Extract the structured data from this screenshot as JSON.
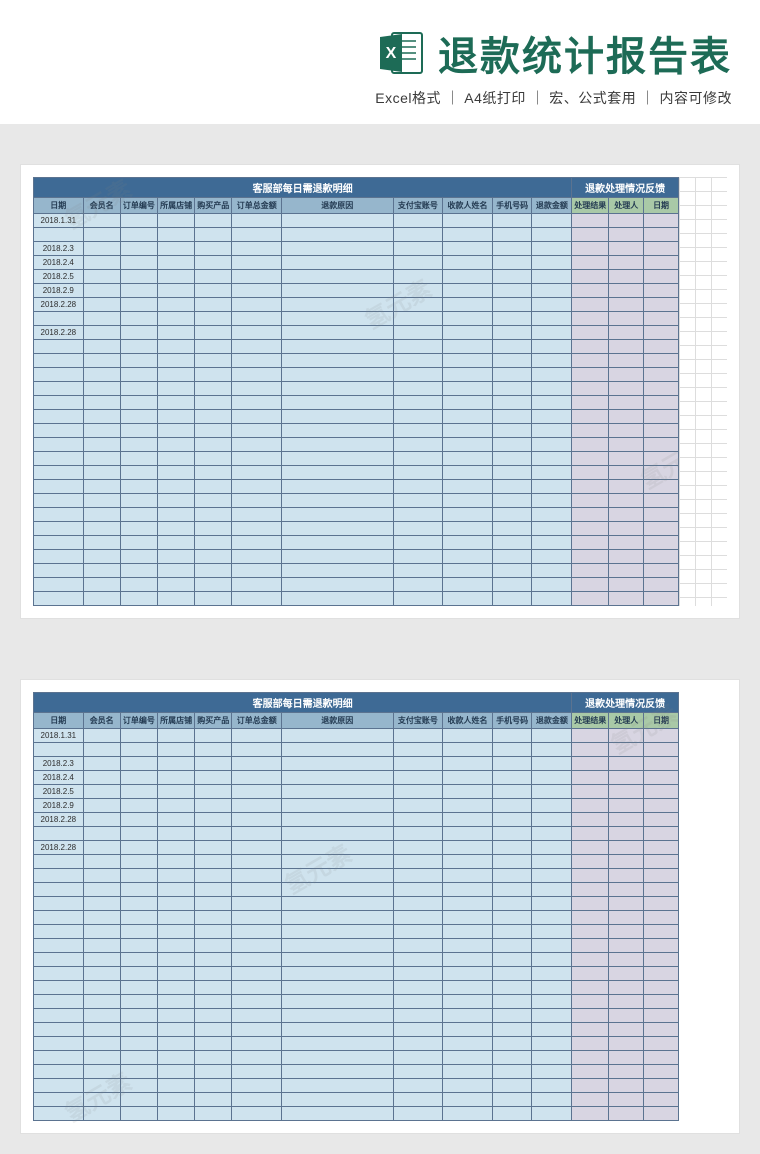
{
  "header": {
    "title": "退款统计报告表",
    "subtitle_parts": [
      "Excel格式",
      "A4纸打印",
      "宏、公式套用",
      "内容可修改"
    ],
    "separator": " ｜ "
  },
  "sheet": {
    "merged_headers": {
      "left": "客服部每日需退款明细",
      "right": "退款处理情况反馈"
    },
    "columns_main": [
      "日期",
      "会员名",
      "订单编号",
      "所属店铺",
      "购买产品",
      "订单总金额",
      "退款原因",
      "支付宝账号",
      "收款人姓名",
      "手机号码",
      "退款金额"
    ],
    "columns_feedback": [
      "处理结果",
      "处理人",
      "日期"
    ],
    "dates": [
      "2018.1.31",
      "",
      "2018.2.3",
      "2018.2.4",
      "2018.2.5",
      "2018.2.9",
      "2018.2.28",
      "",
      "2018.2.28"
    ],
    "total_rows": 28
  },
  "watermark_text": "氢元素"
}
